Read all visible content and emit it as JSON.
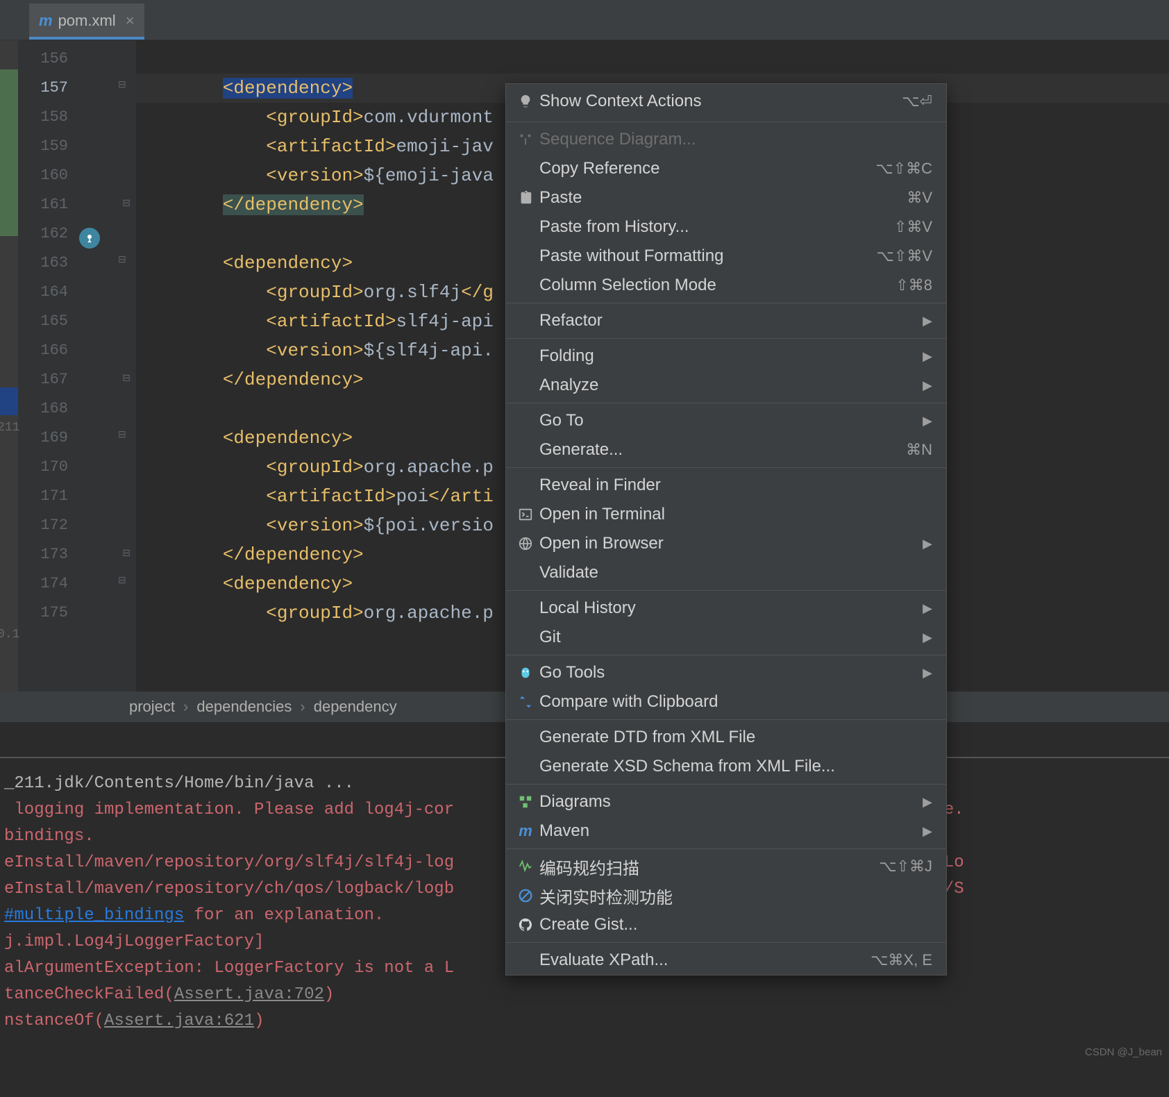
{
  "tab": {
    "filename": "pom.xml"
  },
  "gutter": {
    "start": 156,
    "end": 175
  },
  "highlighted_line": 157,
  "left_num": "211",
  "left_num2": "0.1",
  "code_lines": [
    {
      "n": 156,
      "html": ""
    },
    {
      "n": 157,
      "html": "<span class='hl-o'><span class='tag'>&lt;dependency&gt;</span></span>",
      "hl": true,
      "fold": "open"
    },
    {
      "n": 158,
      "html": "    <span class='tag'>&lt;groupId&gt;</span><span class='txt'>com.vdurmont</span>"
    },
    {
      "n": 159,
      "html": "    <span class='tag'>&lt;artifactId&gt;</span><span class='txt'>emoji-jav</span>"
    },
    {
      "n": 160,
      "html": "    <span class='tag'>&lt;version&gt;</span><span class='txt'>${</span><span class='var'>emoji-java</span>"
    },
    {
      "n": 161,
      "html": "<span class='hl-c'><span class='tag'>&lt;/dependency&gt;</span></span>",
      "fold": "close"
    },
    {
      "n": 162,
      "html": ""
    },
    {
      "n": 163,
      "html": "<span class='tag'>&lt;dependency&gt;</span>",
      "fold": "open",
      "git": true
    },
    {
      "n": 164,
      "html": "    <span class='tag'>&lt;groupId&gt;</span><span class='txt'>org.slf4j</span><span class='tag'>&lt;/g</span>"
    },
    {
      "n": 165,
      "html": "    <span class='tag'>&lt;artifactId&gt;</span><span class='txt'>slf4j-api</span>"
    },
    {
      "n": 166,
      "html": "    <span class='tag'>&lt;version&gt;</span><span class='txt'>${</span><span class='var'>slf4j-api.</span>"
    },
    {
      "n": 167,
      "html": "<span class='tag'>&lt;/dependency&gt;</span>",
      "fold": "close"
    },
    {
      "n": 168,
      "html": ""
    },
    {
      "n": 169,
      "html": "<span class='tag'>&lt;dependency&gt;</span>",
      "fold": "open"
    },
    {
      "n": 170,
      "html": "    <span class='tag'>&lt;groupId&gt;</span><span class='txt'>org.apache.p</span>"
    },
    {
      "n": 171,
      "html": "    <span class='tag'>&lt;artifactId&gt;</span><span class='txt'>poi</span><span class='tag'>&lt;/arti</span>"
    },
    {
      "n": 172,
      "html": "    <span class='tag'>&lt;version&gt;</span><span class='txt'>${</span><span class='var'>poi.versio</span>"
    },
    {
      "n": 173,
      "html": "<span class='tag'>&lt;/dependency&gt;</span>",
      "fold": "close"
    },
    {
      "n": 174,
      "html": "<span class='tag'>&lt;dependency&gt;</span>",
      "fold": "open"
    },
    {
      "n": 175,
      "html": "    <span class='tag'>&lt;groupId&gt;</span><span class='txt'>org.apache.p</span>"
    }
  ],
  "breadcrumb": [
    "project",
    "dependencies",
    "dependency"
  ],
  "menu": [
    {
      "icon": "bulb",
      "label": "Show Context Actions",
      "shortcut": "⌥⏎"
    },
    {
      "sep": true
    },
    {
      "icon": "seq",
      "label": "Sequence Diagram...",
      "disabled": true
    },
    {
      "label": "Copy Reference",
      "shortcut": "⌥⇧⌘C"
    },
    {
      "icon": "paste",
      "label": "Paste",
      "shortcut": "⌘V"
    },
    {
      "label": "Paste from History...",
      "shortcut": "⇧⌘V"
    },
    {
      "label": "Paste without Formatting",
      "shortcut": "⌥⇧⌘V"
    },
    {
      "label": "Column Selection Mode",
      "shortcut": "⇧⌘8"
    },
    {
      "sep": true
    },
    {
      "label": "Refactor",
      "sub": true
    },
    {
      "sep": true
    },
    {
      "label": "Folding",
      "sub": true
    },
    {
      "label": "Analyze",
      "sub": true
    },
    {
      "sep": true
    },
    {
      "label": "Go To",
      "sub": true
    },
    {
      "label": "Generate...",
      "shortcut": "⌘N"
    },
    {
      "sep": true
    },
    {
      "label": "Reveal in Finder"
    },
    {
      "icon": "terminal",
      "label": "Open in Terminal"
    },
    {
      "icon": "browser",
      "label": "Open in Browser",
      "sub": true
    },
    {
      "label": "Validate"
    },
    {
      "sep": true
    },
    {
      "label": "Local History",
      "sub": true
    },
    {
      "label": "Git",
      "sub": true
    },
    {
      "sep": true
    },
    {
      "icon": "gopher",
      "label": "Go Tools",
      "sub": true
    },
    {
      "icon": "compare",
      "label": "Compare with Clipboard"
    },
    {
      "sep": true
    },
    {
      "label": "Generate DTD from XML File"
    },
    {
      "label": "Generate XSD Schema from XML File..."
    },
    {
      "sep": true
    },
    {
      "icon": "diagram",
      "label": "Diagrams",
      "sub": true
    },
    {
      "icon": "maven",
      "label": "Maven",
      "sub": true
    },
    {
      "sep": true
    },
    {
      "icon": "scan",
      "label": "编码规约扫描",
      "shortcut": "⌥⇧⌘J"
    },
    {
      "icon": "ban",
      "label": "关闭实时检测功能"
    },
    {
      "icon": "github",
      "label": "Create Gist..."
    },
    {
      "sep": true
    },
    {
      "label": "Evaluate XPath...",
      "shortcut": "⌥⌘X, E"
    }
  ],
  "console_lines": [
    {
      "cls": "w",
      "text": "_211.jdk/Contents/Home/bin/java ..."
    },
    {
      "cls": "r",
      "text": " logging implementation. Please add log4j-cor                             to log to the console."
    },
    {
      "cls": "r",
      "text": "bindings."
    },
    {
      "cls": "r",
      "text": "eInstall/maven/repository/org/slf4j/slf4j-log                            org/slf4j/impl/StaticLo"
    },
    {
      "cls": "r",
      "text": "eInstall/maven/repository/ch/qos/logback/logb                            8.jar!/org/slf4j/impl/S"
    },
    {
      "cls": "mix",
      "parts": [
        {
          "cls": "link",
          "t": "#multiple_bindings"
        },
        {
          "cls": "r",
          "t": " for an explanation."
        }
      ]
    },
    {
      "cls": "r",
      "text": "j.impl.Log4jLoggerFactory]"
    },
    {
      "cls": "r",
      "text": "alArgumentException: LoggerFactory is not a L                            the classpath. Either "
    },
    {
      "cls": "mix",
      "parts": [
        {
          "cls": "r",
          "t": "tanceCheckFailed("
        },
        {
          "cls": "g",
          "t": "Assert.java:702"
        },
        {
          "cls": "r",
          "t": ")"
        }
      ]
    },
    {
      "cls": "mix",
      "parts": [
        {
          "cls": "r",
          "t": "nstanceOf("
        },
        {
          "cls": "g",
          "t": "Assert.java:621"
        },
        {
          "cls": "r",
          "t": ")"
        }
      ]
    }
  ],
  "watermark": "CSDN @J_bean"
}
